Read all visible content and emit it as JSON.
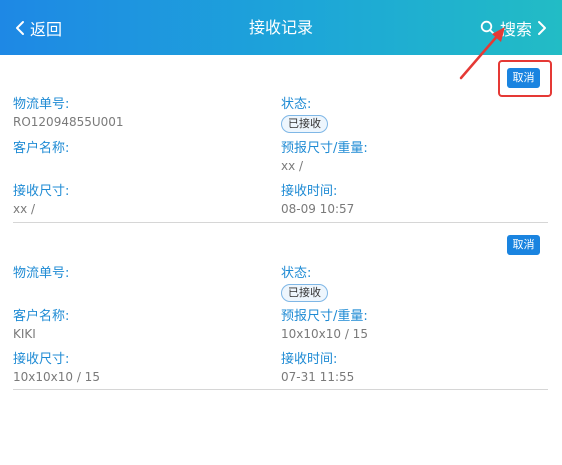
{
  "header": {
    "back_label": "返回",
    "title": "接收记录",
    "search_label": "搜索"
  },
  "colors": {
    "header_gradient_start": "#1e88e5",
    "header_gradient_end": "#22bcc5",
    "accent": "#1a84e0",
    "label_blue": "#1f8bd4",
    "annotation_red": "#e53935"
  },
  "icons": {
    "back": "chevron-left-icon",
    "search": "search-icon",
    "search_arrow": "chevron-right-icon"
  },
  "records": [
    {
      "cancel_label": "取消",
      "fields": {
        "tracking_label": "物流单号:",
        "tracking_value": "RO12094855U001",
        "status_label": "状态:",
        "status_value": "已接收",
        "customer_label": "客户名称:",
        "customer_value": "",
        "forecast_label": "预报尺寸/重量:",
        "forecast_value": "xx /",
        "received_size_label": "接收尺寸:",
        "received_size_value": "xx /",
        "received_time_label": "接收时间:",
        "received_time_value": "08-09 10:57"
      }
    },
    {
      "cancel_label": "取消",
      "fields": {
        "tracking_label": "物流单号:",
        "tracking_value": "",
        "status_label": "状态:",
        "status_value": "已接收",
        "customer_label": "客户名称:",
        "customer_value": "KIKI",
        "forecast_label": "预报尺寸/重量:",
        "forecast_value": "10x10x10 / 15",
        "received_size_label": "接收尺寸:",
        "received_size_value": "10x10x10 / 15",
        "received_time_label": "接收时间:",
        "received_time_value": "07-31 11:55"
      }
    }
  ]
}
